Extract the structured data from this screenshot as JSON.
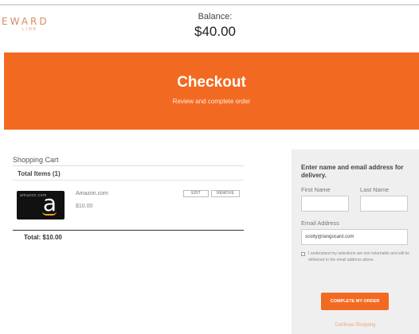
{
  "header": {
    "logo_main": "EWARD",
    "logo_sub": "LINK",
    "balance_label": "Balance:",
    "balance_value": "$40.00"
  },
  "banner": {
    "title": "Checkout",
    "subtitle": "Review and complete order"
  },
  "cart": {
    "title": "Shopping Cart",
    "total_items": "Total Items (1)",
    "items": [
      {
        "card_brand": "amazon.com",
        "card_letter": "a",
        "name": "Amazon.com",
        "price": "$10.00",
        "edit_label": "EDIT",
        "remove_label": "REMOVE"
      }
    ],
    "total": "Total: $10.00"
  },
  "delivery": {
    "heading": "Enter name and email address for delivery.",
    "first_name_label": "First Name",
    "last_name_label": "Last Name",
    "first_name_value": "",
    "last_name_value": "",
    "email_label": "Email Address",
    "email_value": "scotty@tangocard.com",
    "checkbox_text": "I understand my selections are non-returnable and will be delivered to the email address above.",
    "complete_label": "COMPLETE MY ORDER",
    "continue_label": "Continue Shopping"
  },
  "colors": {
    "accent": "#f26a21",
    "panel_bg": "#efefef"
  }
}
